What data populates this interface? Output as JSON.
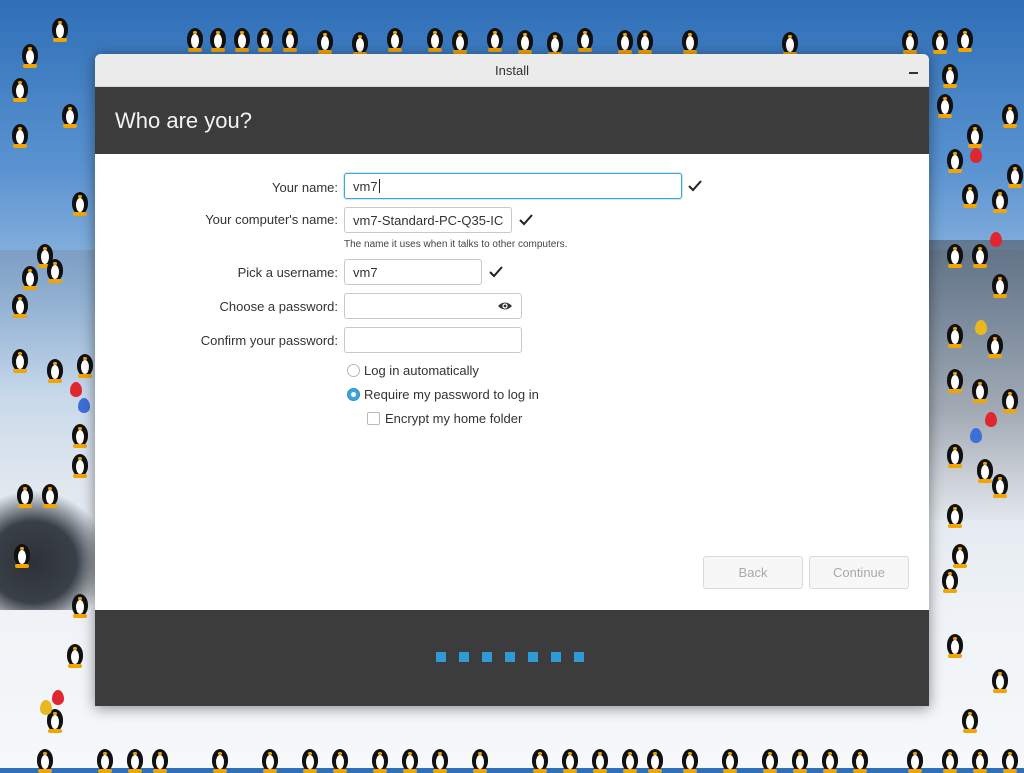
{
  "window": {
    "title": "Install",
    "header_title": "Who are you?"
  },
  "form": {
    "name_label": "Your name:",
    "name_value": "vm7",
    "computer_label": "Your computer's name:",
    "computer_value": "vm7-Standard-PC-Q35-IC",
    "computer_hint": "The name it uses when it talks to other computers.",
    "username_label": "Pick a username:",
    "username_value": "vm7",
    "password_label": "Choose a password:",
    "password_value": "",
    "confirm_label": "Confirm your password:",
    "confirm_value": "",
    "login_auto_label": "Log in automatically",
    "login_auto_checked": false,
    "require_password_label": "Require my password to log in",
    "require_password_checked": true,
    "encrypt_label": "Encrypt my home folder",
    "encrypt_checked": false
  },
  "buttons": {
    "back": "Back",
    "continue": "Continue"
  },
  "progress": {
    "dots": 7
  },
  "icons": {
    "valid": "checkmark-icon",
    "show_password": "eye-icon",
    "minimize": "minimize-icon"
  },
  "colors": {
    "accent": "#3da5d9",
    "header_bg": "#3c3c3c",
    "progress": "#2f9bd6"
  }
}
